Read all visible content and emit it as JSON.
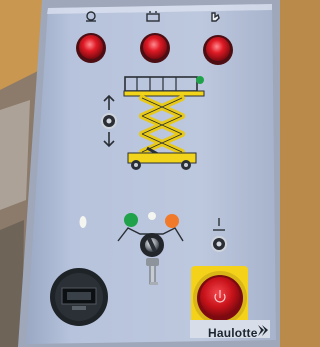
{
  "panel": {
    "brand": "Haulotte",
    "colors": {
      "panel": "#b8c4dc",
      "button_red": "#d9141c",
      "lift_yellow": "#f2d41a",
      "emergency_yellow": "#f4d21a",
      "lamp_green": "#1fa24a",
      "lamp_orange": "#f07a2a"
    },
    "top_indicators": [
      {
        "icon": "engine-icon",
        "lamp": "red"
      },
      {
        "icon": "battery-icon",
        "lamp": "red"
      },
      {
        "icon": "hand-icon",
        "lamp": "red"
      }
    ],
    "lift_control": {
      "icons": [
        "arrow-up-icon",
        "arrow-down-icon"
      ],
      "type": "toggle-switch"
    },
    "key_switch": {
      "lamps": [
        "green",
        "white",
        "orange"
      ],
      "type": "key-switch"
    },
    "hour_meter": {
      "type": "hour-meter"
    },
    "emergency_stop": {
      "type": "emergency-stop-button"
    }
  }
}
